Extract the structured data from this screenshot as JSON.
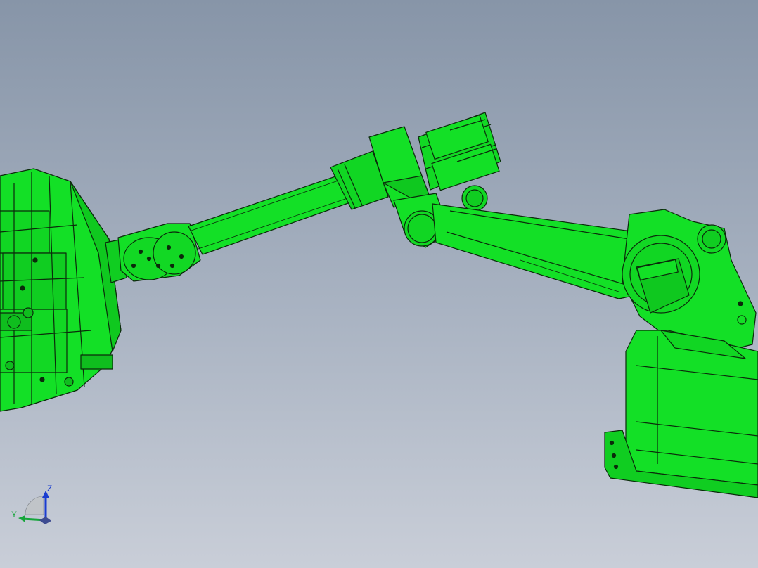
{
  "viewport": {
    "background_top": "#8795a8",
    "background_bottom": "#c9ced8",
    "part_color": "#13e026",
    "edge_color": "#0b2a0b"
  },
  "triad": {
    "z_label": "Z",
    "y_label": "Y",
    "z_color": "#1a3cd0",
    "y_color": "#16a63a"
  }
}
